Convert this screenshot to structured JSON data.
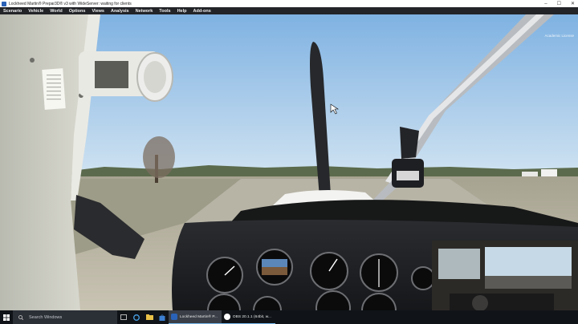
{
  "window": {
    "title": "Lockheed Martin® Prepar3D® v3 with WideServer: waiting for clients",
    "minimize": "–",
    "maximize": "☐",
    "close": "✕"
  },
  "menu": [
    "Scenario",
    "Vehicle",
    "World",
    "Options",
    "Views",
    "Analysis",
    "Network",
    "Tools",
    "Help",
    "Add-ons"
  ],
  "watermark": "Academic License",
  "taskbar": {
    "search_placeholder": "Search Windows",
    "apps": [
      {
        "label": "Lockheed Martin® P...",
        "icon": "prepar3d-icon"
      },
      {
        "label": "OBS 20.1.1 (64bit, w...",
        "icon": "obs-icon"
      }
    ],
    "icons": [
      "task-view-icon",
      "edge-icon",
      "file-explorer-icon",
      "store-icon"
    ]
  },
  "colors": {
    "sky": "#8fbbe4",
    "menubar": "#222428",
    "taskbar": "#101418",
    "panel": "#1b1d20",
    "accent": "#76b9ed"
  }
}
